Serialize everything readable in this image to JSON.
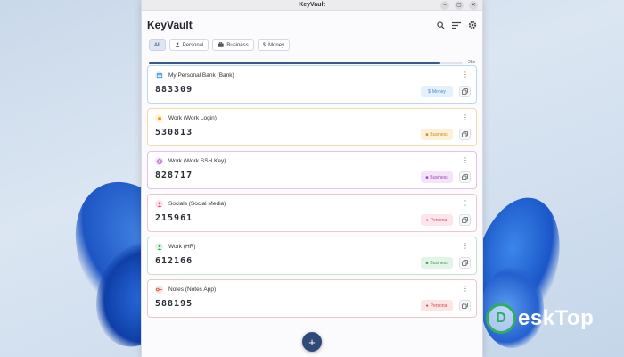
{
  "window": {
    "title": "KeyVault"
  },
  "app": {
    "title": "KeyVault"
  },
  "header_icons": [
    "search-icon",
    "sort-icon",
    "gear-icon"
  ],
  "filters": [
    {
      "label": "All",
      "icon": "",
      "active": true
    },
    {
      "label": "Personal",
      "icon": "person-icon",
      "active": false
    },
    {
      "label": "Business",
      "icon": "briefcase-icon",
      "active": false
    },
    {
      "label": "Money",
      "icon": "dollar-icon",
      "active": false
    }
  ],
  "timer": {
    "label": "28s",
    "progress": 0.93
  },
  "entries": [
    {
      "name": "My Personal Bank (Bank)",
      "code": "883309",
      "tag": "Money",
      "icon": "card-icon",
      "icon_color": "#3b8fd8",
      "icon_bg": "#dbeefc",
      "tag_color": "#4a88c7",
      "tag_bg": "#e4f0fb",
      "border": "#b9d9f0"
    },
    {
      "name": "Work (Work Login)",
      "code": "530813",
      "tag": "Business",
      "icon": "sun-icon",
      "icon_color": "#e8a317",
      "icon_bg": "#fdf1d6",
      "tag_color": "#d18a10",
      "tag_bg": "#fdf0d8",
      "border": "#f0dca8"
    },
    {
      "name": "Work (Work SSH Key)",
      "code": "828717",
      "tag": "Business",
      "icon": "globe-icon",
      "icon_color": "#9b3fc0",
      "icon_bg": "#f2e0f8",
      "tag_color": "#9b3fc0",
      "tag_bg": "#f4e3f9",
      "border": "#e2c2ec"
    },
    {
      "name": "Socials (Social Media)",
      "code": "215961",
      "tag": "Personal",
      "icon": "person-icon",
      "icon_color": "#e0457a",
      "icon_bg": "#fbe1ea",
      "tag_color": "#d8456f",
      "tag_bg": "#fce6ec",
      "border": "#f1c4d1"
    },
    {
      "name": "Work (HR)",
      "code": "612166",
      "tag": "Business",
      "icon": "person-icon",
      "icon_color": "#3aa35a",
      "icon_bg": "#e0f3e5",
      "tag_color": "#3a9a55",
      "tag_bg": "#e3f4e7",
      "border": "#c3e4cc"
    },
    {
      "name": "Notes (Notes App)",
      "code": "588195",
      "tag": "Personal",
      "icon": "key-icon",
      "icon_color": "#d94040",
      "icon_bg": "#fbe2e2",
      "tag_color": "#d24848",
      "tag_bg": "#fce5e5",
      "border": "#f0c6c6"
    }
  ],
  "watermark": {
    "letter": "D",
    "text": "eskTop"
  }
}
